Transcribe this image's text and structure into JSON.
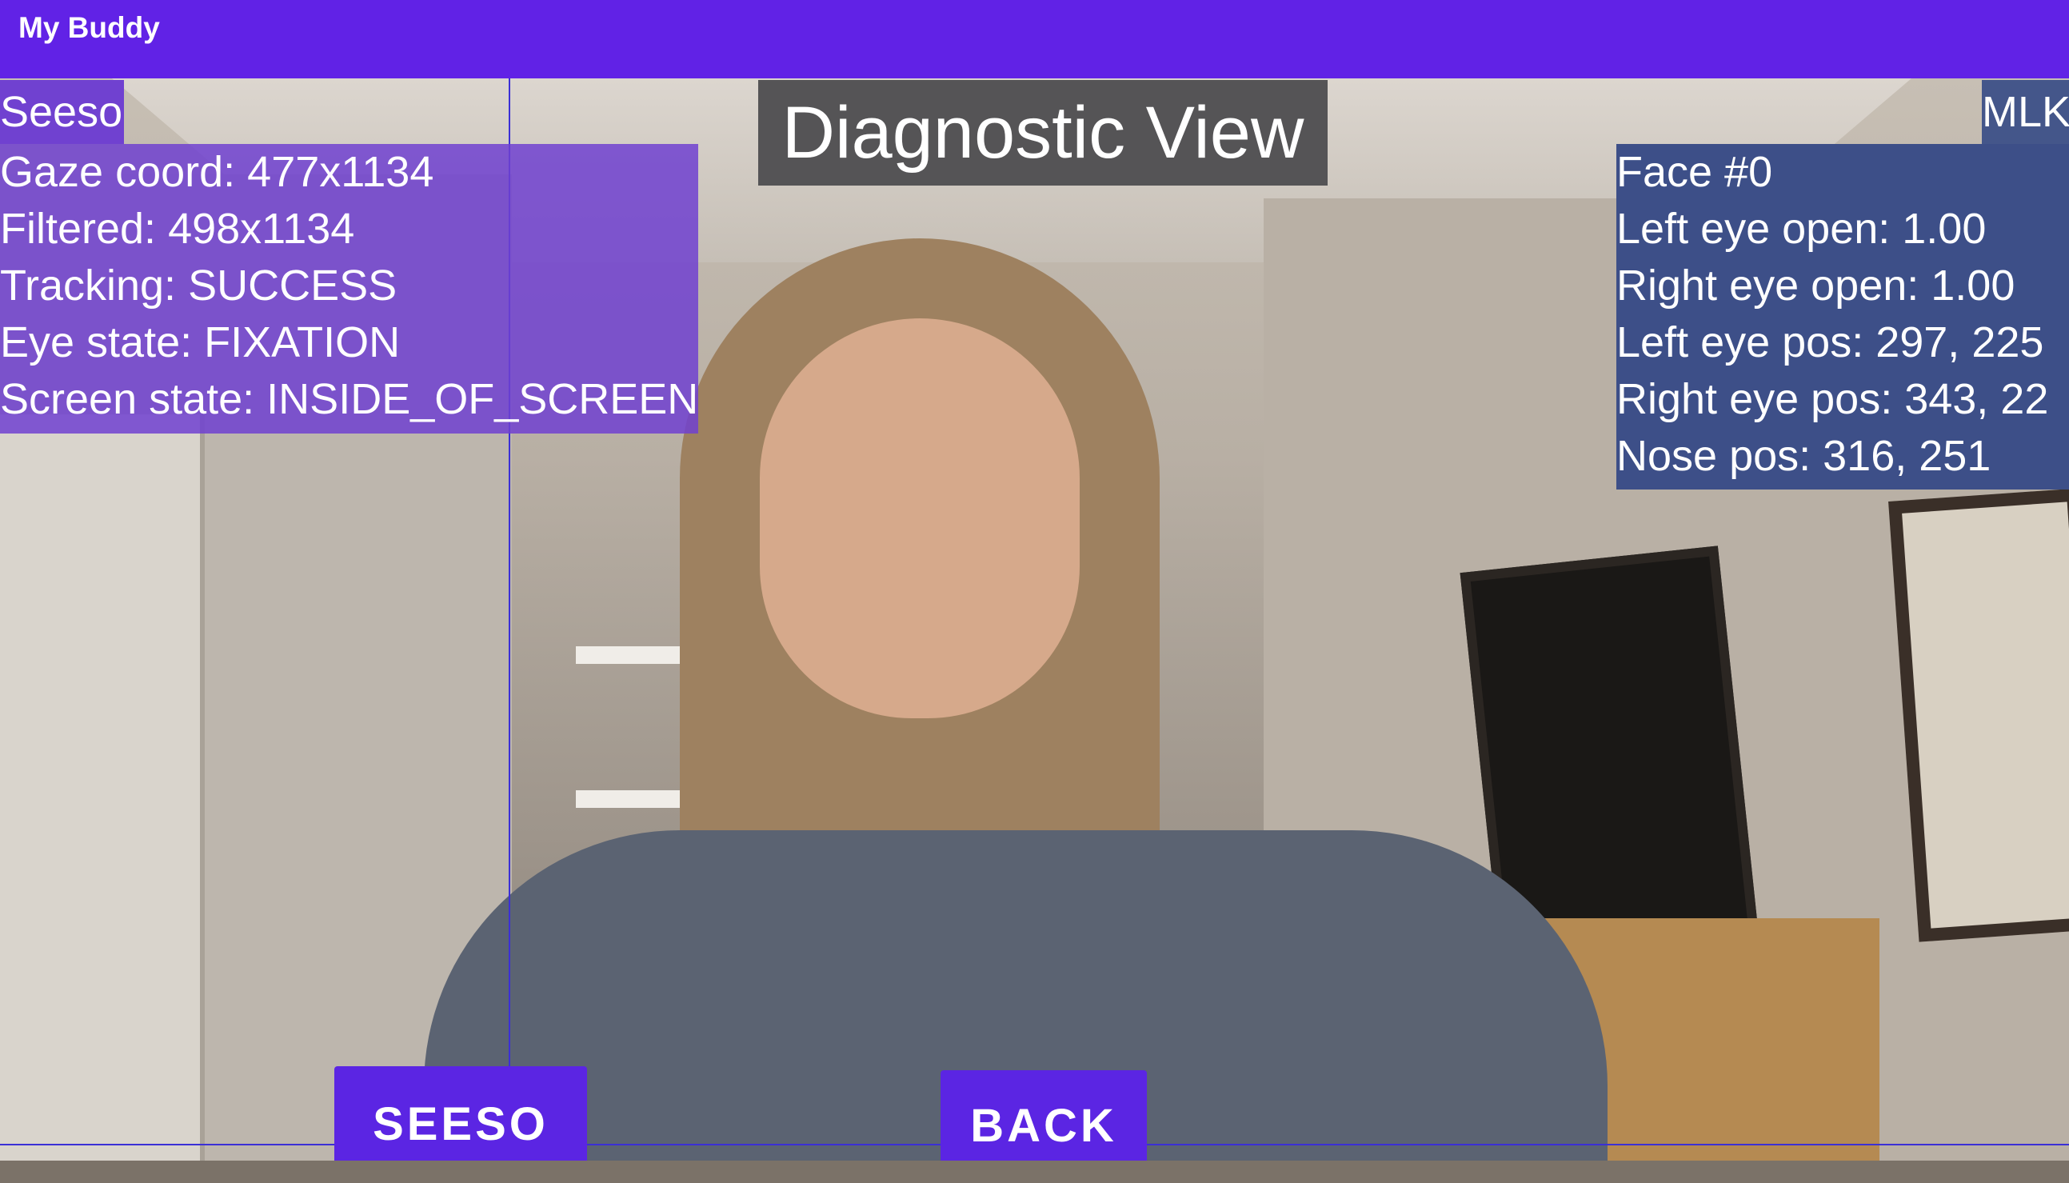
{
  "app": {
    "title": "My Buddy"
  },
  "header": {
    "title": "Diagnostic View"
  },
  "seeso": {
    "label": "Seeso",
    "lines": [
      "Gaze coord: 477x1134",
      "Filtered: 498x1134",
      "Tracking: SUCCESS",
      "Eye state: FIXATION",
      "Screen state: INSIDE_OF_SCREEN"
    ]
  },
  "mlk": {
    "label": "MLK",
    "lines": [
      "Face #0",
      "Left eye open: 1.00",
      "Right eye open: 1.00",
      "Left eye pos: 297, 225",
      "Right eye pos: 343, 22",
      "Nose pos: 316, 251"
    ]
  },
  "buttons": {
    "seeso": "SEESO",
    "back": "BACK"
  },
  "colors": {
    "appbar": "#6122e6",
    "seeso_panel": "#7041d0",
    "mlk_panel": "#3d4f88",
    "button": "#5b25e3"
  }
}
